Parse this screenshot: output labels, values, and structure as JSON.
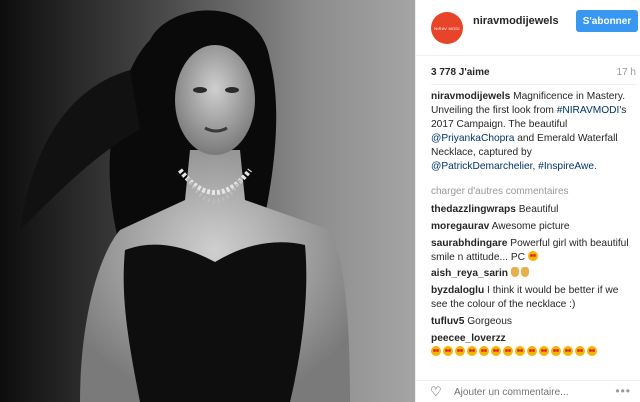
{
  "post": {
    "username": "niravmodijewels",
    "avatar_text": "NIRAV MODI",
    "follow_label": "S'abonner",
    "likes": "3 778 J'aime",
    "time": "17 h"
  },
  "caption": {
    "username": "niravmodijewels",
    "text_1": " Magnificence in Mastery.",
    "text_2": "Unveiling the first look from ",
    "hashtag_1": "#NIRAVMODI",
    "text_3": "'s 2017 Campaign. The beautiful ",
    "mention_1": "@PriyankaChopra",
    "text_4": " and Emerald Waterfall Necklace, captured by ",
    "mention_2": "@PatrickDemarchelier",
    "text_5": ", ",
    "hashtag_2": "#InspireAwe",
    "text_6": "."
  },
  "load_more": "charger d'autres commentaires",
  "comments": [
    {
      "user": "thedazzlingwraps",
      "text": " Beautiful"
    },
    {
      "user": "moregaurav",
      "text": " Awesome picture"
    },
    {
      "user": "saurabhdingare",
      "text": " Powerful girl with beautiful smile n attitude... PC "
    },
    {
      "user": "aish_reya_sarin",
      "text": " "
    },
    {
      "user": "byzdaloglu",
      "text": " I think it would be better if we see the colour of the necklace :)"
    },
    {
      "user": "tufluv5",
      "text": " Gorgeous"
    },
    {
      "user": "peecee_loverzz",
      "text": " "
    }
  ],
  "footer": {
    "comment_placeholder": "Ajouter un commentaire..."
  },
  "icons": {
    "like": "heart-icon",
    "more": "more-options-icon"
  },
  "colors": {
    "follow_button": "#3897f0",
    "avatar": "#e8442a",
    "link": "#003569"
  }
}
